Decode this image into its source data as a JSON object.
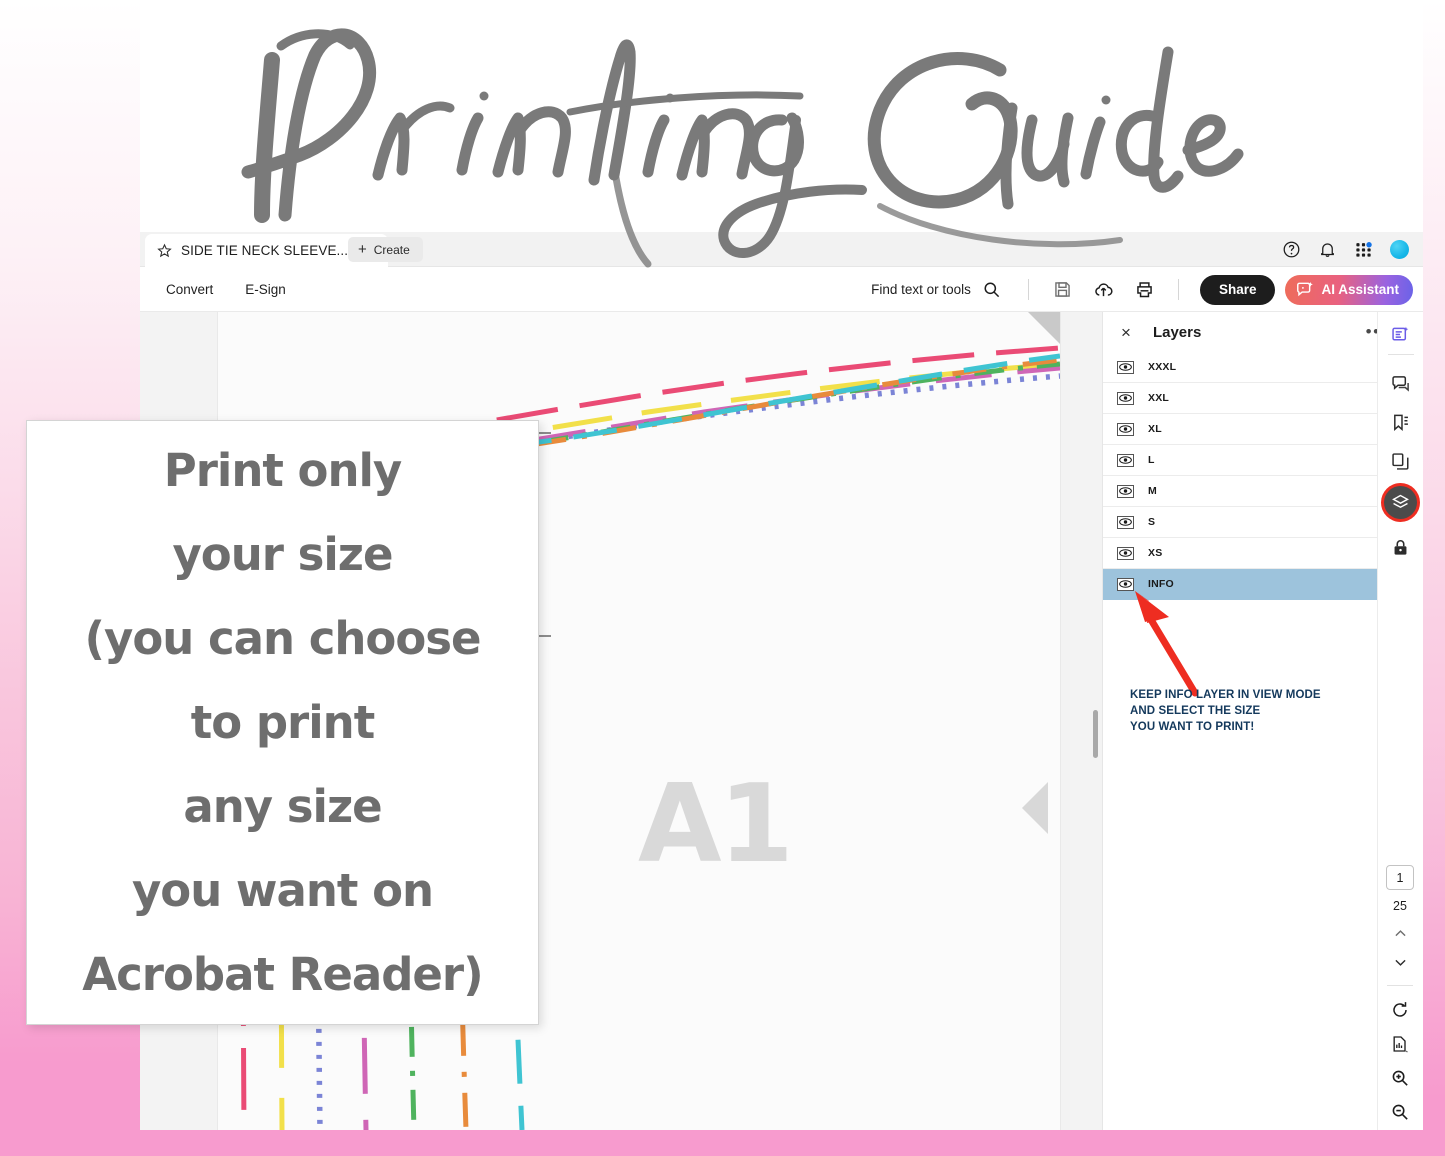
{
  "decor": {
    "title": "Printing Guide",
    "border_color": "#f79bce",
    "title_color": "#6e6e6e"
  },
  "callout": {
    "lines": [
      "Print only",
      "your size",
      "(you can choose",
      "to print",
      "any size",
      "you want on",
      "Acrobat Reader)"
    ]
  },
  "tabbar": {
    "tab_label": "SIDE TIE NECK SLEEVE...",
    "tab_close": "×",
    "create_label": "Create",
    "create_plus": "+",
    "icons": [
      "star-icon",
      "help-icon",
      "bell-icon",
      "app-grid-icon",
      "avatar"
    ]
  },
  "toolbar": {
    "convert_label": "Convert",
    "esign_label": "E-Sign",
    "find_label": "Find text or tools",
    "share_label": "Share",
    "ai_label": "AI Assistant",
    "icons": [
      "search-icon",
      "save-icon",
      "upload-cloud-icon",
      "print-icon"
    ],
    "ai_gradient_from": "#ee6c5a",
    "ai_gradient_to": "#6a63e8"
  },
  "document": {
    "watermark": "A1",
    "page_bg": "#fbfbfb"
  },
  "layers": {
    "panel_title": "Layers",
    "close_glyph": "×",
    "menu_glyph": "•••",
    "highlight_color": "#9dc3dc",
    "items": [
      {
        "name": "XXXL",
        "visible": true,
        "selected": false
      },
      {
        "name": "XXL",
        "visible": true,
        "selected": false
      },
      {
        "name": "XL",
        "visible": true,
        "selected": false
      },
      {
        "name": "L",
        "visible": true,
        "selected": false
      },
      {
        "name": "M",
        "visible": true,
        "selected": false
      },
      {
        "name": "S",
        "visible": true,
        "selected": false
      },
      {
        "name": "XS",
        "visible": true,
        "selected": false
      },
      {
        "name": "INFO",
        "visible": true,
        "selected": true
      }
    ],
    "annotation": {
      "line1": "KEEP INFO LAYER IN VIEW MODE",
      "line2": "AND SELECT THE SIZE",
      "line3": "YOU WANT TO PRINT!",
      "color": "#14395c",
      "arrow_color": "#ee2d21"
    }
  },
  "rail": {
    "icons": [
      "edit-pdf-ai-icon",
      "comment-icon",
      "bookmark-icon",
      "organize-pages-icon",
      "layers-icon",
      "protect-lock-icon"
    ],
    "active": "layers-icon",
    "active_ring_color": "#ee2d21"
  },
  "pagenav": {
    "current_page": "1",
    "total_pages": "25",
    "icons": [
      "chevron-up-icon",
      "chevron-down-icon",
      "rotate-icon",
      "fit-page-icon",
      "zoom-in-icon",
      "zoom-out-icon"
    ]
  },
  "pattern": {
    "colors": {
      "XXXL": "#ea4b75",
      "XXL": "#f2e04a",
      "XL": "#7b84d6",
      "L": "#cf66b6",
      "M": "#4fb35e",
      "S": "#e88b3c",
      "XS": "#3fc4d2"
    }
  }
}
